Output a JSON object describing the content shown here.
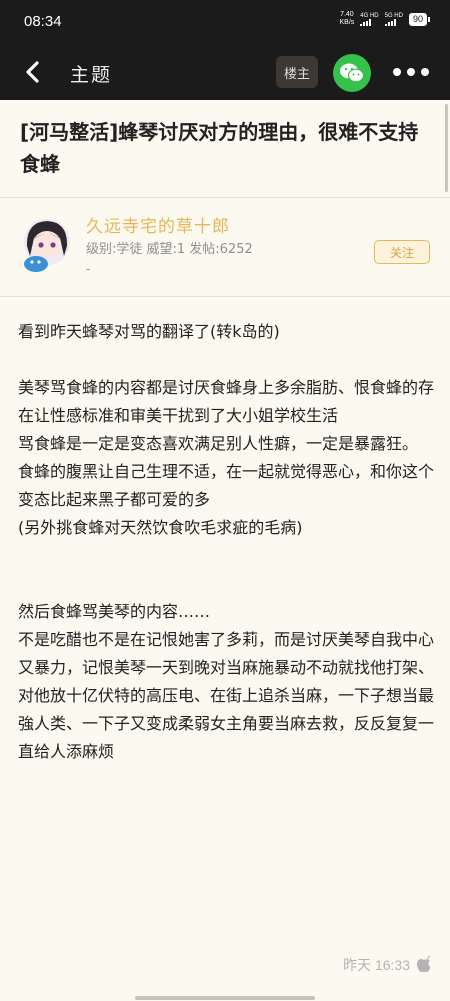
{
  "status_bar": {
    "time": "08:34",
    "net_speed_value": "7.40",
    "net_speed_unit": "KB/s",
    "sim1": "4G HD",
    "sim2": "5G HD",
    "battery": "90"
  },
  "nav": {
    "title": "主题",
    "op_label": "楼主",
    "icons": [
      "back-icon",
      "wechat-icon",
      "more-icon"
    ]
  },
  "thread": {
    "title": "[河马整活]蜂琴讨厌对方的理由，很难不支持食蜂"
  },
  "author": {
    "name": "久远寺宅的草十郎",
    "meta": "级别:学徒  威望:1  发帖:6252",
    "extra": "-",
    "follow_label": "关注"
  },
  "post": {
    "paragraphs": [
      "看到昨天蜂琴对骂的翻译了(转k岛的)",
      "美琴骂食蜂的内容都是讨厌食蜂身上多余脂肪、恨食蜂的存在让性感标准和审美干扰到了大小姐学校生活\n骂食蜂是一定是变态喜欢满足别人性癖，一定是暴露狂。\n食蜂的腹黑让自己生理不适，在一起就觉得恶心，和你这个变态比起来黑子都可爱的多\n(另外挑食蜂对天然饮食吹毛求疵的毛病)",
      "然后食蜂骂美琴的内容……\n不是吃醋也不是在记恨她害了多莉，而是讨厌美琴自我中心又暴力，记恨美琴一天到晚对当麻施暴动不动就找他打架、对他放十亿伏特的高压电、在街上追杀当麻，一下子想当最強人类、一下子又变成柔弱女主角要当麻去救，反反复复一直给人添麻烦"
    ],
    "time": "昨天 16:33"
  },
  "colors": {
    "bar_bg": "#1b1b1b",
    "page_bg": "#fbf9f0",
    "accent_gold": "#e8b657",
    "wechat_green": "#34c24b"
  }
}
